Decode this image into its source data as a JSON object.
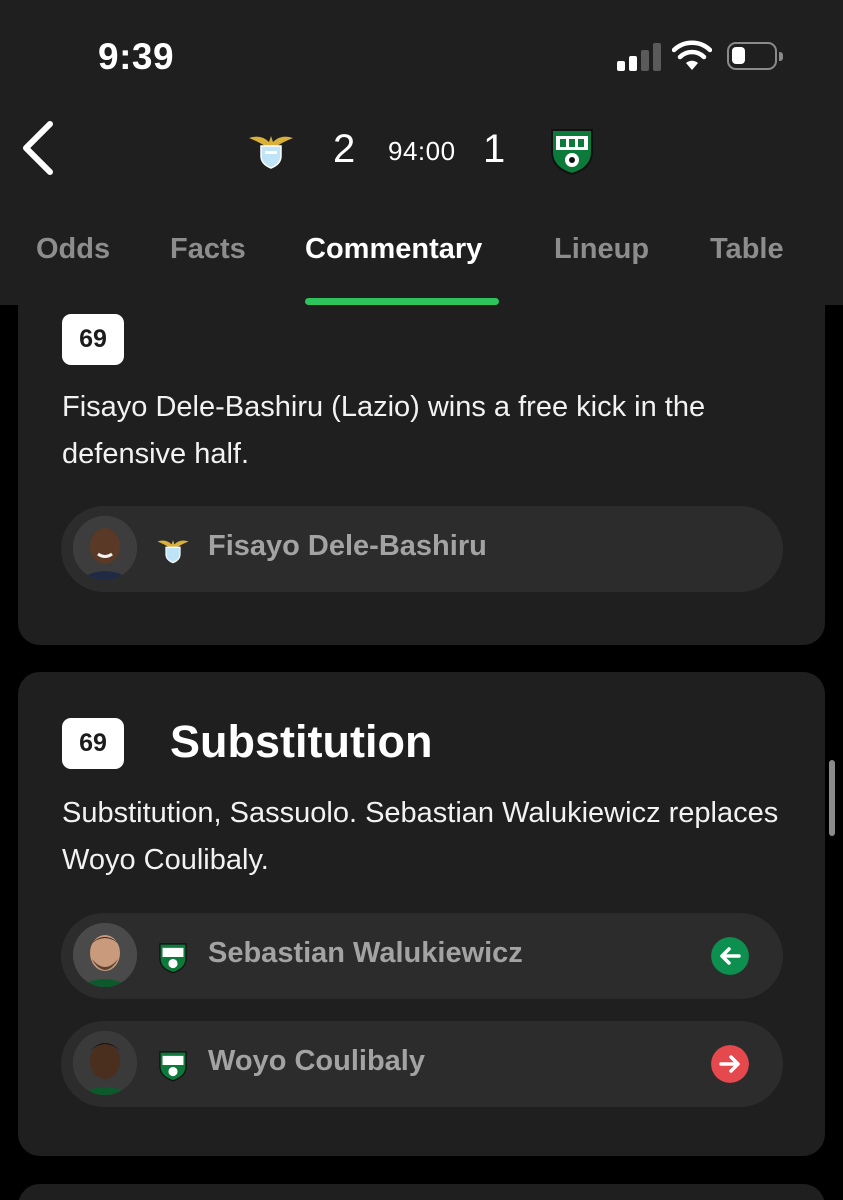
{
  "status_bar": {
    "time": "9:39"
  },
  "match": {
    "home_score": "2",
    "away_score": "1",
    "clock": "94:00",
    "home_crest_icon": "lazio-crest-icon",
    "away_crest_icon": "sassuolo-crest-icon"
  },
  "tabs": [
    {
      "label": "Odds",
      "active": false
    },
    {
      "label": "Facts",
      "active": false
    },
    {
      "label": "Commentary",
      "active": true
    },
    {
      "label": "Lineup",
      "active": false
    },
    {
      "label": "Table",
      "active": false
    }
  ],
  "feed": [
    {
      "minute": "69",
      "text": "Fisayo Dele-Bashiru (Lazio) wins a free kick in the defensive half.",
      "players": [
        {
          "name": "Fisayo Dele-Bashiru",
          "team_icon": "lazio-crest-icon"
        }
      ]
    },
    {
      "minute": "69",
      "title": "Substitution",
      "text": "Substitution, Sassuolo. Sebastian Walukiewicz replaces Woyo Coulibaly.",
      "players": [
        {
          "name": "Sebastian Walukiewicz",
          "team_icon": "sassuolo-crest-icon",
          "direction": "in",
          "arrow_icon": "arrow-left-icon",
          "arrow_color": "#0d8f4f"
        },
        {
          "name": "Woyo Coulibaly",
          "team_icon": "sassuolo-crest-icon",
          "direction": "out",
          "arrow_icon": "arrow-right-icon",
          "arrow_color": "#e5484d"
        }
      ]
    }
  ],
  "colors": {
    "accent": "#2ec45c",
    "background": "#000000",
    "surface": "#1f1f1f",
    "pill": "#2c2c2c"
  }
}
